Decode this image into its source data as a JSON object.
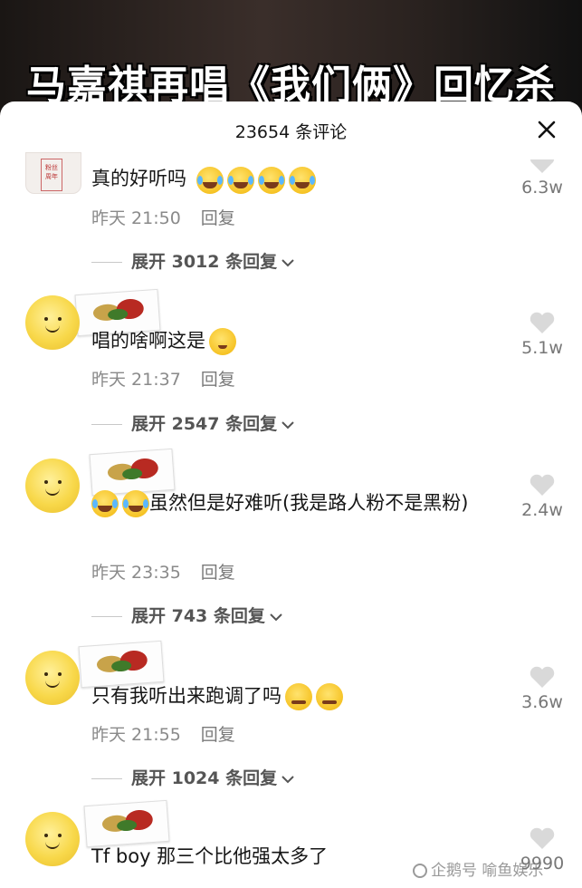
{
  "video": {
    "title": "马嘉祺再唱《我们俩》回忆杀"
  },
  "sheet": {
    "title": "23654 条评论",
    "close_icon": "close-icon"
  },
  "comments": [
    {
      "avatar": "photo-avatar",
      "avatar_badge": "粉丝 周年",
      "text": "真的好听吗",
      "emojis": [
        "tear",
        "tear",
        "tear",
        "tear"
      ],
      "time": "昨天 21:50",
      "reply": "回复",
      "expand": "展开 3012 条回复",
      "likes": "6.3w"
    },
    {
      "avatar": "smiley-avatar",
      "text": "唱的啥啊这是",
      "emojis": [
        "think"
      ],
      "time": "昨天 21:37",
      "reply": "回复",
      "expand": "展开 2547 条回复",
      "likes": "5.1w"
    },
    {
      "avatar": "smiley-avatar",
      "text_prefix_emojis": [
        "tear",
        "tear"
      ],
      "text": "虽然但是好难听(我是路人粉不是黑粉)",
      "time": "昨天 23:35",
      "reply": "回复",
      "expand": "展开 743 条回复",
      "likes": "2.4w"
    },
    {
      "avatar": "smiley-avatar",
      "text": "只有我听出来跑调了吗",
      "emojis": [
        "zip",
        "zip"
      ],
      "time": "昨天 21:55",
      "reply": "回复",
      "expand": "展开 1024 条回复",
      "likes": "3.6w"
    },
    {
      "avatar": "smiley-avatar",
      "text": "Tf boy 那三个比他强太多了",
      "likes": "9990"
    }
  ],
  "watermark": "企鹅号 喻鱼娱乐",
  "colors": {
    "like_heart": "#d9d9d9",
    "meta_text": "#8a8a8a"
  }
}
